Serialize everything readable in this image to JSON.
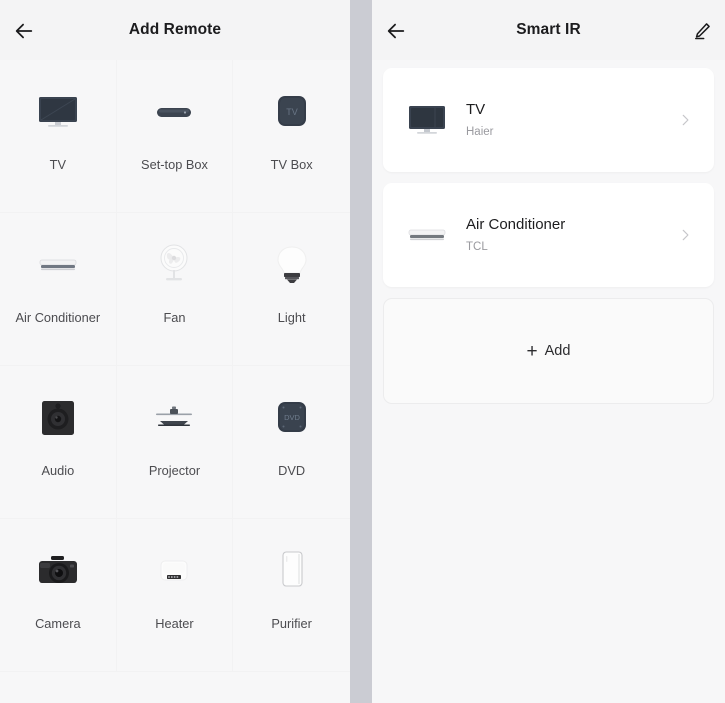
{
  "left_panel": {
    "header": {
      "title": "Add Remote",
      "back_icon": "arrow-left-icon"
    },
    "devices": [
      {
        "label": "TV",
        "icon": "tv-icon"
      },
      {
        "label": "Set-top Box",
        "icon": "set-top-box-icon"
      },
      {
        "label": "TV Box",
        "icon": "tv-box-icon"
      },
      {
        "label": "Air Conditioner",
        "icon": "air-conditioner-icon"
      },
      {
        "label": "Fan",
        "icon": "fan-icon"
      },
      {
        "label": "Light",
        "icon": "light-bulb-icon"
      },
      {
        "label": "Audio",
        "icon": "audio-speaker-icon"
      },
      {
        "label": "Projector",
        "icon": "projector-icon"
      },
      {
        "label": "DVD",
        "icon": "dvd-player-icon"
      },
      {
        "label": "Camera",
        "icon": "camera-icon"
      },
      {
        "label": "Heater",
        "icon": "heater-icon"
      },
      {
        "label": "Purifier",
        "icon": "air-purifier-icon"
      }
    ]
  },
  "right_panel": {
    "header": {
      "title": "Smart IR",
      "back_icon": "arrow-left-icon",
      "edit_icon": "pencil-edit-icon"
    },
    "remotes": [
      {
        "name": "TV",
        "brand": "Haier",
        "icon": "tv-icon",
        "chevron": "chevron-right-icon"
      },
      {
        "name": "Air Conditioner",
        "brand": "TCL",
        "icon": "air-conditioner-icon",
        "chevron": "chevron-right-icon"
      }
    ],
    "add_button": {
      "label": "Add",
      "plus": "+"
    }
  },
  "colors": {
    "panel_background": "#f7f7f8",
    "appbar_background": "#f4f4f5",
    "gap": "#cbccd3",
    "card_background": "#ffffff",
    "title_text": "#1c1c1e",
    "caption_text": "#4c4c50",
    "brand_text": "#9a9a9f",
    "device_dark": "#333a44"
  }
}
